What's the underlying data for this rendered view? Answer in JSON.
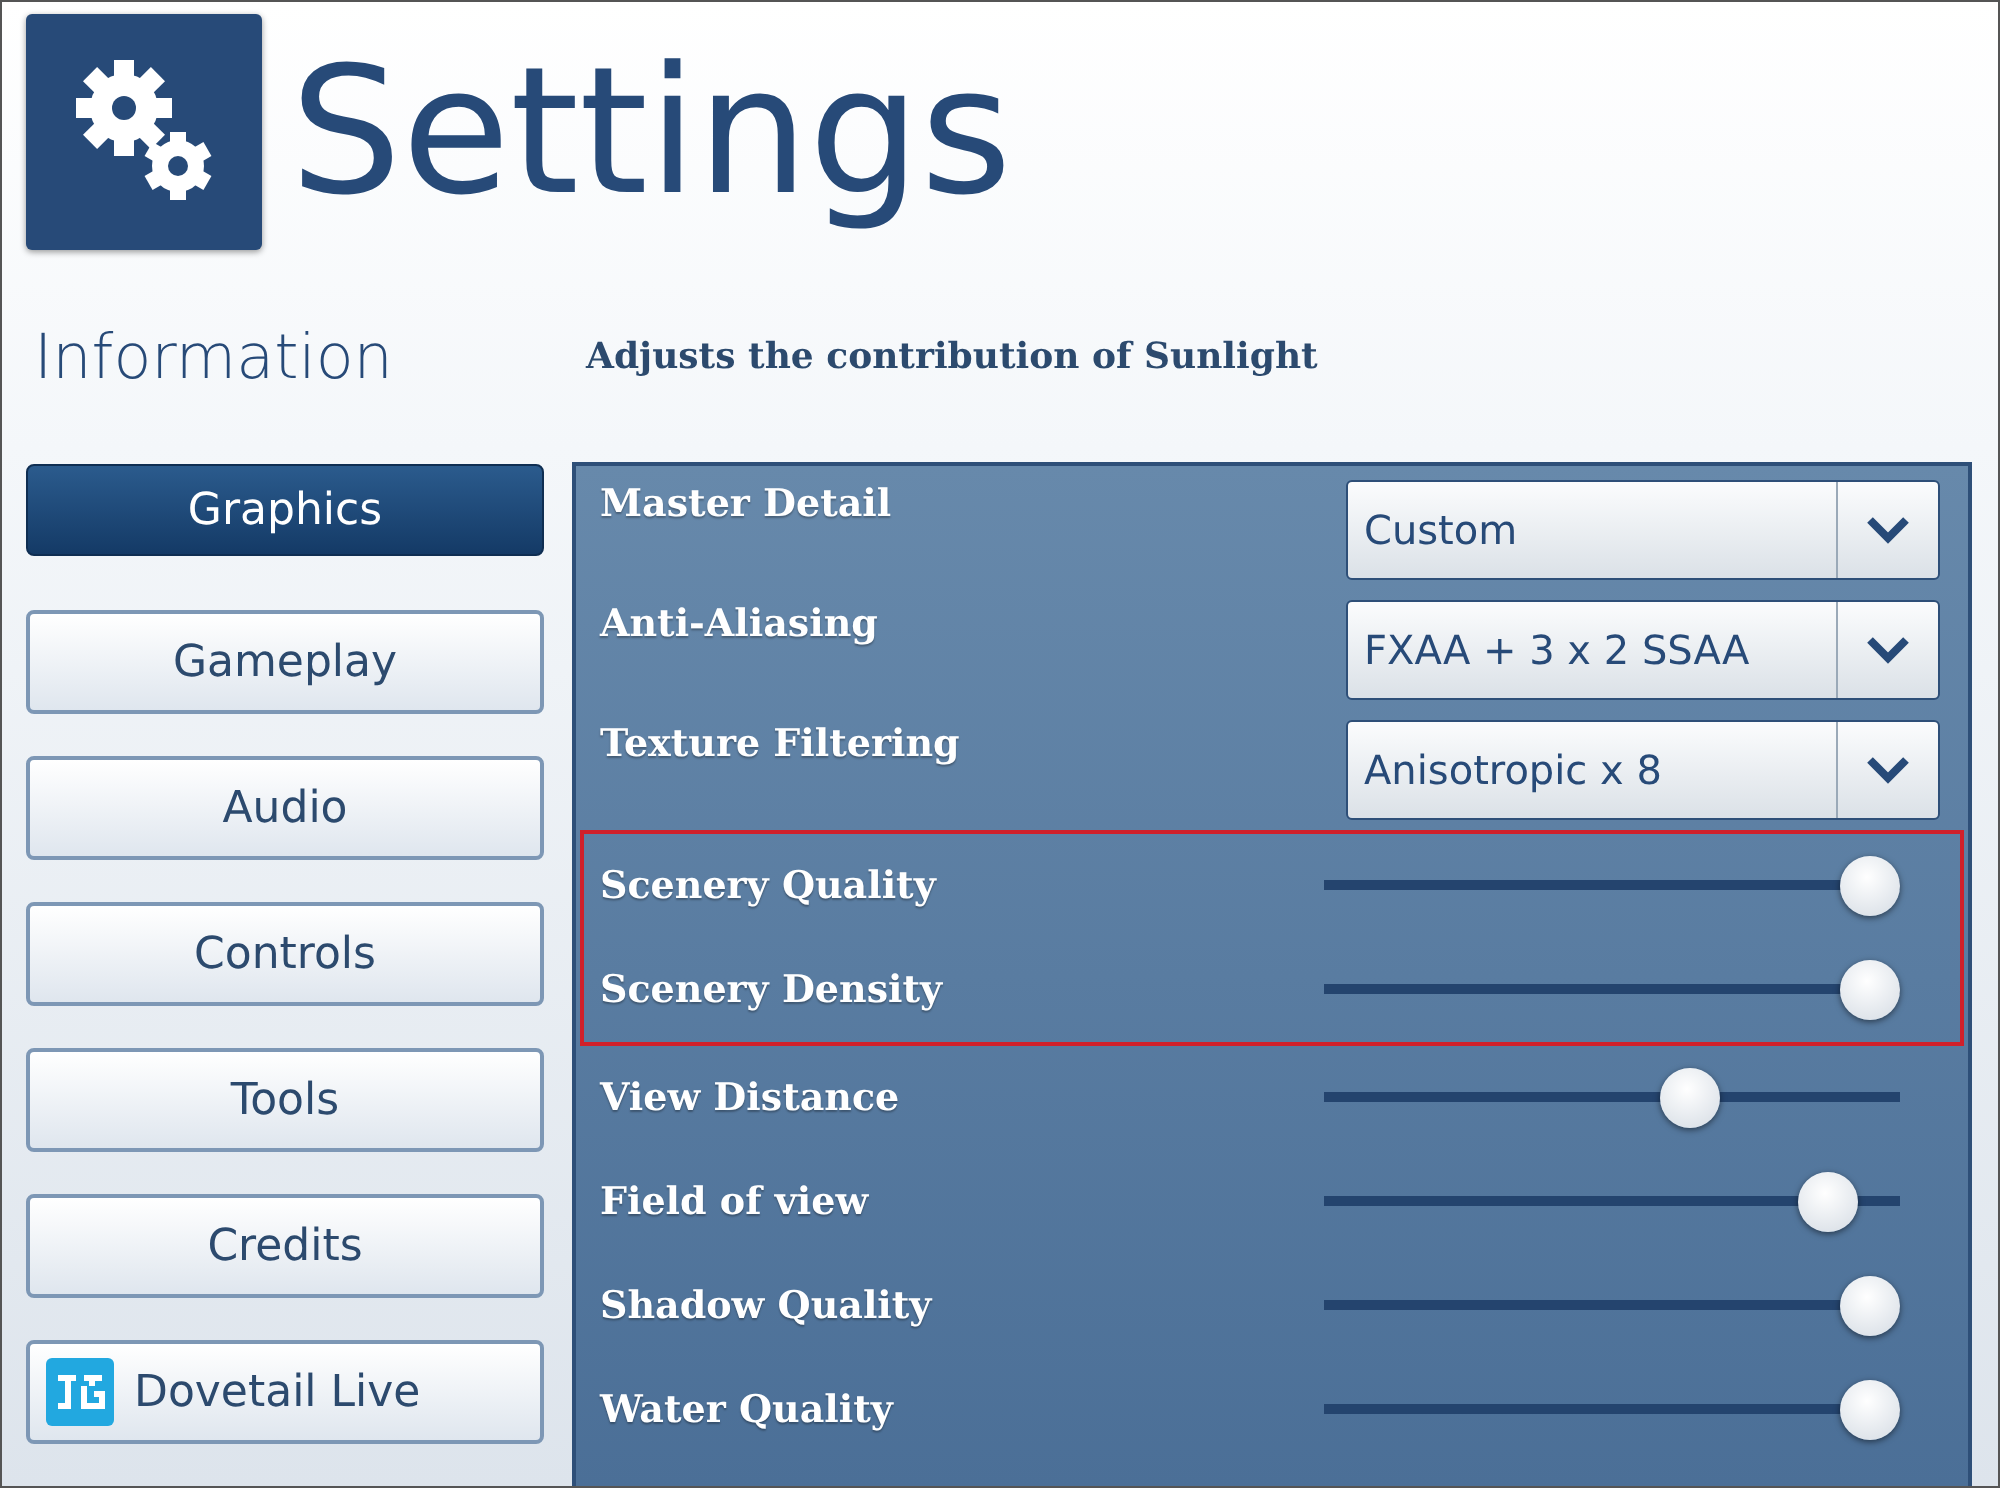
{
  "header": {
    "title": "Settings"
  },
  "section_title": "Information",
  "description": "Adjusts the contribution of Sunlight",
  "sidebar": {
    "items": [
      {
        "label": "Graphics",
        "selected": true,
        "kind": "button"
      },
      {
        "label": "Gameplay",
        "selected": false,
        "kind": "button"
      },
      {
        "label": "Audio",
        "selected": false,
        "kind": "button"
      },
      {
        "label": "Controls",
        "selected": false,
        "kind": "button"
      },
      {
        "label": "Tools",
        "selected": false,
        "kind": "button"
      },
      {
        "label": "Credits",
        "selected": false,
        "kind": "button"
      },
      {
        "label": "Dovetail Live",
        "selected": false,
        "kind": "logo-button"
      }
    ]
  },
  "settings": [
    {
      "kind": "dropdown",
      "label": "Master Detail",
      "value": "Custom",
      "highlighted": false
    },
    {
      "kind": "dropdown",
      "label": "Anti-Aliasing",
      "value": "FXAA + 3 x 2 SSAA",
      "highlighted": false
    },
    {
      "kind": "dropdown",
      "label": "Texture Filtering",
      "value": "Anisotropic x 8",
      "highlighted": false
    },
    {
      "kind": "slider",
      "label": "Scenery Quality",
      "level": 1,
      "highlighted": true
    },
    {
      "kind": "slider",
      "label": "Scenery Density",
      "level": 1,
      "highlighted": true
    },
    {
      "kind": "slider",
      "label": "View Distance",
      "level": 0.65,
      "highlighted": false
    },
    {
      "kind": "slider",
      "label": "Field of view",
      "level": 0.92,
      "highlighted": false
    },
    {
      "kind": "slider",
      "label": "Shadow Quality",
      "level": 1,
      "highlighted": false
    },
    {
      "kind": "slider",
      "label": "Water Quality",
      "level": 1,
      "highlighted": false
    }
  ]
}
